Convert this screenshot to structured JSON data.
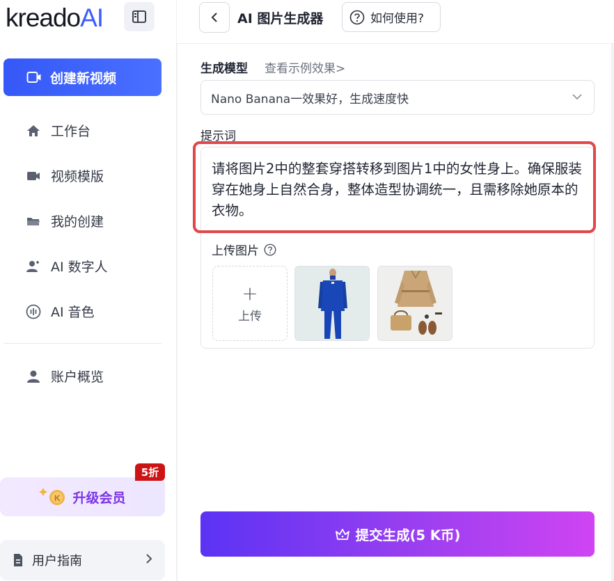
{
  "brand": {
    "logo_main": "kreado",
    "logo_ai": "AI"
  },
  "sidebar": {
    "create_label": "创建新视频",
    "items": [
      {
        "label": "工作台",
        "icon": "home-icon"
      },
      {
        "label": "视频模版",
        "icon": "video-camera-icon"
      },
      {
        "label": "我的创建",
        "icon": "folder-icon"
      },
      {
        "label": "AI 数字人",
        "icon": "user-add-icon"
      },
      {
        "label": "AI 音色",
        "icon": "sound-wave-icon"
      }
    ],
    "account_label": "账户概览",
    "upgrade_label": "升级会员",
    "discount_badge": "5折",
    "guide_label": "用户指南"
  },
  "header": {
    "title": "AI 图片生成器",
    "help_label": "如何使用?"
  },
  "form": {
    "model_label": "生成模型",
    "example_link": "查看示例效果>",
    "model_value": "Nano Banana一效果好，生成速度快",
    "prompt_label": "提示词",
    "prompt_text": "请将图片2中的整套穿搭转移到图片1中的女性身上。确保服装穿在她身上自然合身，整体造型协调统一，且需移除她原本的衣物。",
    "upload_label": "上传图片",
    "upload_button": "上传",
    "submit_label": "提交生成(5 K币)"
  },
  "colors": {
    "primary": "#3b5cff",
    "submit_start": "#5b33f4",
    "submit_end": "#cf44f3",
    "highlight": "#e0474a",
    "badge": "#cc1414"
  }
}
